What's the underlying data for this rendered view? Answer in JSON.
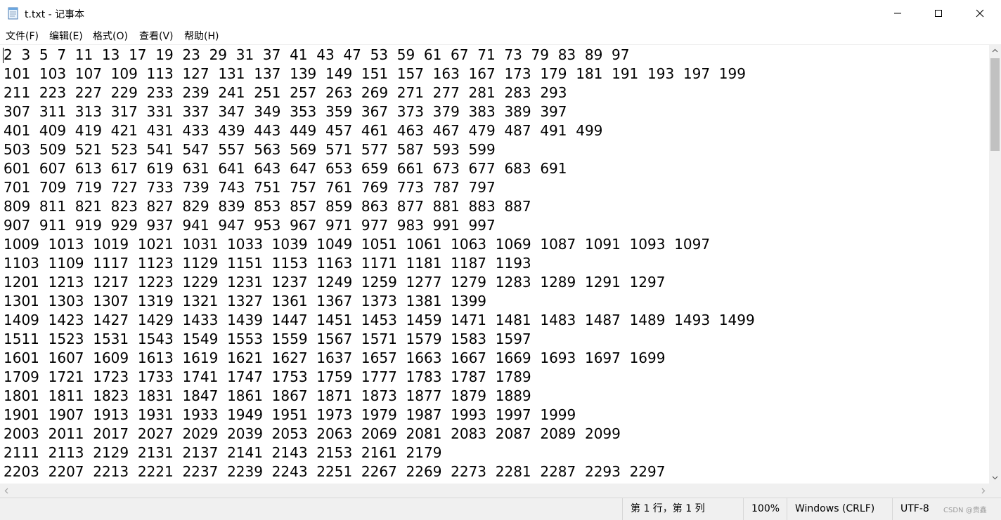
{
  "window": {
    "title": "t.txt - 记事本"
  },
  "menu": {
    "file": "文件(F)",
    "edit": "编辑(E)",
    "format": "格式(O)",
    "view": "查看(V)",
    "help": "帮助(H)"
  },
  "editor": {
    "lines": [
      "2  3  5  7  11  13  17  19  23  29  31  37  41  43  47  53  59  61  67  71  73  79  83  89  97",
      "101  103  107  109  113  127  131  137  139  149  151  157  163  167  173  179  181  191  193  197  199",
      "211  223  227  229  233  239  241  251  257  263  269  271  277  281  283  293",
      "307  311  313  317  331  337  347  349  353  359  367  373  379  383  389  397",
      "401  409  419  421  431  433  439  443  449  457  461  463  467  479  487  491  499",
      "503  509  521  523  541  547  557  563  569  571  577  587  593  599",
      "601  607  613  617  619  631  641  643  647  653  659  661  673  677  683  691",
      "701  709  719  727  733  739  743  751  757  761  769  773  787  797",
      "809  811  821  823  827  829  839  853  857  859  863  877  881  883  887",
      "907  911  919  929  937  941  947  953  967  971  977  983  991  997",
      "1009  1013  1019  1021  1031  1033  1039  1049  1051  1061  1063  1069  1087  1091  1093  1097",
      "1103  1109  1117  1123  1129  1151  1153  1163  1171  1181  1187  1193",
      "1201  1213  1217  1223  1229  1231  1237  1249  1259  1277  1279  1283  1289  1291  1297",
      "1301  1303  1307  1319  1321  1327  1361  1367  1373  1381  1399",
      "1409  1423  1427  1429  1433  1439  1447  1451  1453  1459  1471  1481  1483  1487  1489  1493  1499",
      "1511  1523  1531  1543  1549  1553  1559  1567  1571  1579  1583  1597",
      "1601  1607  1609  1613  1619  1621  1627  1637  1657  1663  1667  1669  1693  1697  1699",
      "1709  1721  1723  1733  1741  1747  1753  1759  1777  1783  1787  1789",
      "1801  1811  1823  1831  1847  1861  1867  1871  1873  1877  1879  1889",
      "1901  1907  1913  1931  1933  1949  1951  1973  1979  1987  1993  1997  1999",
      "2003  2011  2017  2027  2029  2039  2053  2063  2069  2081  2083  2087  2089  2099",
      "2111  2113  2129  2131  2137  2141  2143  2153  2161  2179",
      "2203  2207  2213  2221  2237  2239  2243  2251  2267  2269  2273  2281  2287  2293  2297"
    ]
  },
  "status": {
    "position": "第 1 行，第 1 列",
    "zoom": "100%",
    "line_ending": "Windows (CRLF)",
    "encoding": "UTF-8"
  },
  "watermark": "CSDN @贵鑫",
  "icons": {
    "app": "notepad-icon",
    "minimize": "minimize-icon",
    "maximize": "maximize-icon",
    "close": "close-icon"
  }
}
